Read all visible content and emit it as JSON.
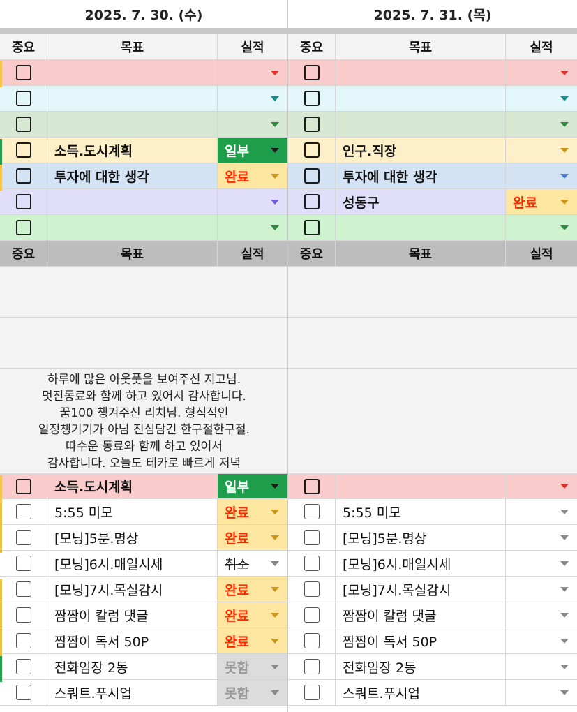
{
  "colors": {
    "red": "#f9cbcb",
    "cyan": "#e3f7fb",
    "green": "#d7e8d2",
    "yellow": "#fdf0c8",
    "blue": "#d3e3f4",
    "lavender": "#e1defa",
    "lightgreen": "#cff3cf",
    "status_partial_bg": "#1e9e4a",
    "status_done_bg": "#fde6a0",
    "status_done_fg": "#ff2a00",
    "status_fail_bg": "#dcdcdc",
    "status_fail_fg": "#9a9a9a",
    "header_gray": "#bdbdbd"
  },
  "days": [
    {
      "date": "2025. 7. 30. (수)",
      "headers": {
        "importance": "중요",
        "goal": "목표",
        "result": "실적"
      },
      "top_rows": [
        {
          "color": "red",
          "goal": "",
          "status": "",
          "arrow": "red"
        },
        {
          "color": "cyan",
          "goal": "",
          "status": "",
          "arrow": "teal"
        },
        {
          "color": "green",
          "goal": "",
          "status": "",
          "arrow": "green"
        },
        {
          "color": "yellow",
          "goal": "소득.도시계획",
          "status": "일부",
          "status_type": "partial",
          "arrow": "dark"
        },
        {
          "color": "blue",
          "goal": "투자에 대한 생각",
          "status": "완료",
          "status_type": "done",
          "arrow": "amber"
        },
        {
          "color": "lavender",
          "goal": "",
          "status": "",
          "arrow": "violet"
        },
        {
          "color": "lightgreen",
          "goal": "",
          "status": "",
          "arrow": "green"
        }
      ],
      "memo": [
        "하루에 많은 아웃풋을 보여주신 지고님.",
        "멋진동료와 함께 하고 있어서 감사합니다.",
        "꿈100 챙겨주신 리치님. 형식적인",
        "일정챙기기가 아님 진심담긴 한구절한구절.",
        "따수운 동료와 함께 하고 있어서",
        "감사합니다. 오늘도 테카로 빠르게 저녁"
      ],
      "focus": {
        "goal": "소득.도시계획",
        "status": "일부",
        "status_type": "partial"
      },
      "routines": [
        {
          "goal": "5:55 미모",
          "status": "완료",
          "status_type": "done"
        },
        {
          "goal": "[모닝]5분.명상",
          "status": "완료",
          "status_type": "done"
        },
        {
          "goal": "[모닝]6시.매일시세",
          "status": "취소",
          "status_type": "cancel"
        },
        {
          "goal": "[모닝]7시.목실감시",
          "status": "완료",
          "status_type": "done"
        },
        {
          "goal": "짬짬이 칼럼 댓글",
          "status": "완료",
          "status_type": "done"
        },
        {
          "goal": "짬짬이 독서 50P",
          "status": "완료",
          "status_type": "done"
        },
        {
          "goal": "전화임장 2동",
          "status": "못함",
          "status_type": "fail"
        },
        {
          "goal": "스쿼트.푸시업",
          "status": "못함",
          "status_type": "fail"
        }
      ]
    },
    {
      "date": "2025. 7. 31. (목)",
      "headers": {
        "importance": "중요",
        "goal": "목표",
        "result": "실적"
      },
      "top_rows": [
        {
          "color": "red",
          "goal": "",
          "status": "",
          "arrow": "red"
        },
        {
          "color": "cyan",
          "goal": "",
          "status": "",
          "arrow": "teal"
        },
        {
          "color": "green",
          "goal": "",
          "status": "",
          "arrow": "green"
        },
        {
          "color": "yellow",
          "goal": "인구.직장",
          "status": "",
          "arrow": "amber"
        },
        {
          "color": "blue",
          "goal": "투자에 대한 생각",
          "status": "",
          "arrow": "blue"
        },
        {
          "color": "lavender",
          "goal": "성동구",
          "status": "완료",
          "status_type": "done",
          "arrow": "amber"
        },
        {
          "color": "lightgreen",
          "goal": "",
          "status": "",
          "arrow": "green"
        }
      ],
      "memo": [],
      "focus": {
        "goal": "",
        "status": "",
        "status_type": ""
      },
      "routines": [
        {
          "goal": "5:55 미모",
          "status": "",
          "status_type": ""
        },
        {
          "goal": "[모닝]5분.명상",
          "status": "",
          "status_type": ""
        },
        {
          "goal": "[모닝]6시.매일시세",
          "status": "",
          "status_type": ""
        },
        {
          "goal": "[모닝]7시.목실감시",
          "status": "",
          "status_type": ""
        },
        {
          "goal": "짬짬이 칼럼 댓글",
          "status": "",
          "status_type": ""
        },
        {
          "goal": "짬짬이 독서 50P",
          "status": "",
          "status_type": ""
        },
        {
          "goal": "전화임장 2동",
          "status": "",
          "status_type": ""
        },
        {
          "goal": "스쿼트.푸시업",
          "status": "",
          "status_type": ""
        }
      ]
    }
  ]
}
